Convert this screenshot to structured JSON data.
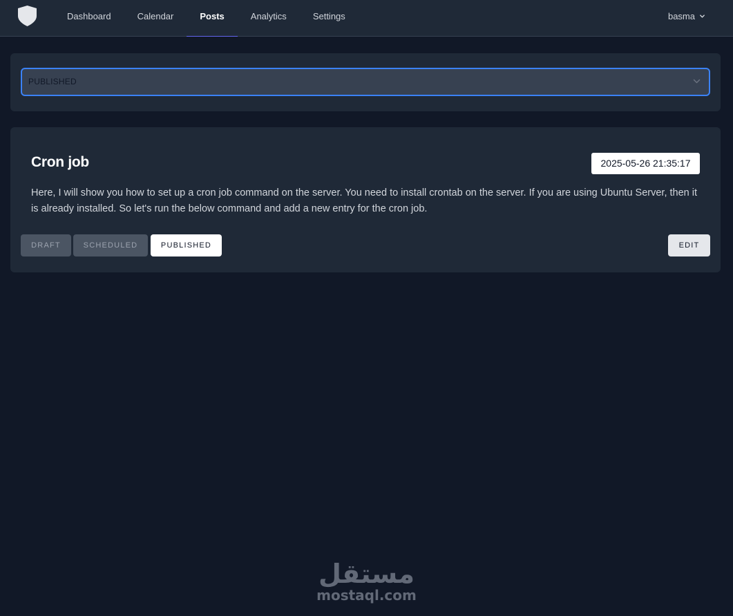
{
  "nav": {
    "items": [
      {
        "label": "Dashboard",
        "name": "nav-item-dashboard",
        "active": false
      },
      {
        "label": "Calendar",
        "name": "nav-item-calendar",
        "active": false
      },
      {
        "label": "Posts",
        "name": "nav-item-posts",
        "active": true
      },
      {
        "label": "Analytics",
        "name": "nav-item-analytics",
        "active": false
      },
      {
        "label": "Settings",
        "name": "nav-item-settings",
        "active": false
      }
    ],
    "user": "basma",
    "logo_icon": "shield-icon",
    "user_chevron_icon": "chevron-down-icon"
  },
  "filter": {
    "selected": "PUBLISHED",
    "chevron_icon": "chevron-down-icon"
  },
  "post": {
    "title": "Cron job",
    "date": "2025-05-26 21:35:17",
    "body": "Here, I will show you how to set up a cron job command on the server. You need to install crontab on the server. If you are using Ubuntu Server, then it is already installed. So let's run the below command and add a new entry for the cron job.",
    "status_buttons": {
      "draft": "DRAFT",
      "scheduled": "SCHEDULED",
      "published": "PUBLISHED"
    },
    "active_status": "published",
    "edit_label": "EDIT"
  },
  "watermark": {
    "arabic": "مستقل",
    "latin": "mostaql.com"
  },
  "colors": {
    "background": "#111827",
    "surface": "#1f2937",
    "accent": "#3b82f6",
    "nav_indicator": "#6366f1"
  }
}
